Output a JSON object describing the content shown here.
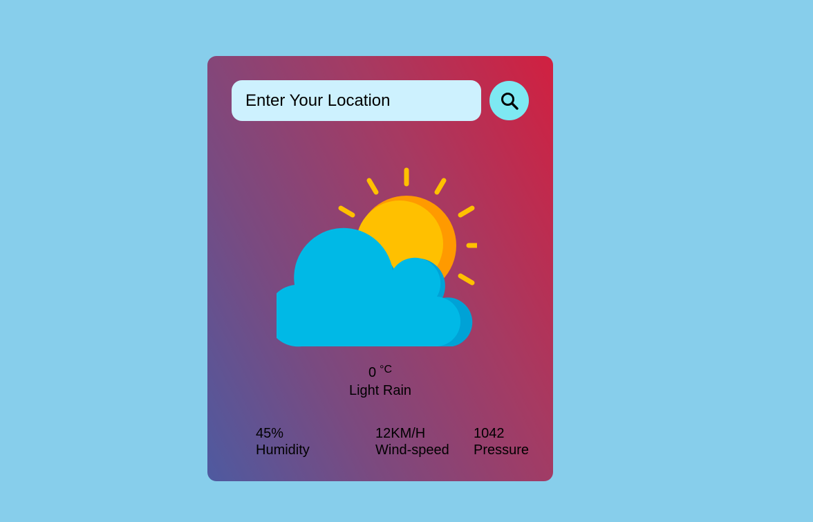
{
  "search": {
    "placeholder": "Enter Your Location",
    "button_icon": "search-icon"
  },
  "weather": {
    "icon": "partly-cloudy-icon",
    "temperature": "0",
    "unit": "°C",
    "condition": "Light Rain"
  },
  "stats": [
    {
      "value": "45%",
      "label": "Humidity"
    },
    {
      "value": "12KM/H",
      "label": "Wind-speed"
    },
    {
      "value": "1042",
      "label": "Pressure"
    }
  ],
  "colors": {
    "page_background": "#87ceeb",
    "card_gradient_start": "#4e5aa0",
    "card_gradient_end": "#d12040",
    "input_background": "#cdf1fe",
    "button_background": "#7ee8f2",
    "sun": "#ffc000",
    "sun_shade": "#ff9a00",
    "cloud": "#00b9e6",
    "cloud_shade": "#00a2d6"
  }
}
